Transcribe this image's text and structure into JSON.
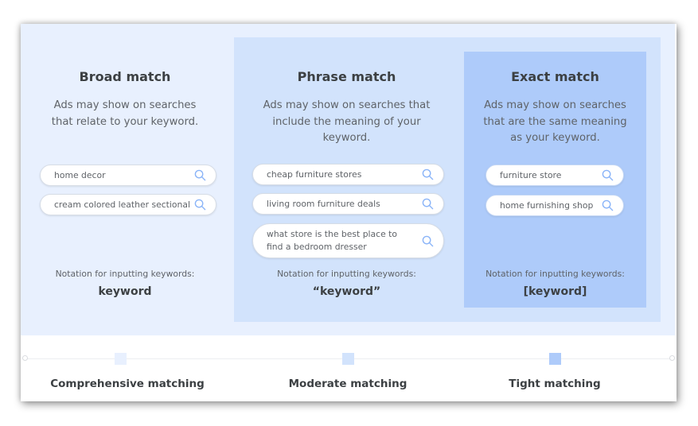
{
  "colors": {
    "broad_bg": "#e8f0fe",
    "phrase_bg": "#d2e3fc",
    "exact_bg": "#aecbfa",
    "search_icon": "#8ab4f8",
    "heading_text": "#3c4043",
    "body_text": "#5f6368"
  },
  "columns": [
    {
      "title": "Broad match",
      "description_lines": [
        "Ads may show on searches",
        "that relate to your keyword."
      ],
      "searches": [
        "home decor",
        "cream colored leather sectional"
      ],
      "notation_label": "Notation for inputting keywords:",
      "notation": "keyword"
    },
    {
      "title": "Phrase match",
      "description_lines": [
        "Ads may show on searches that",
        "include the meaning of your",
        "keyword."
      ],
      "searches": [
        "cheap furniture stores",
        "living room furniture deals",
        "what store is the best place to find a bedroom dresser"
      ],
      "notation_label": "Notation for inputting keywords:",
      "notation": "“keyword”"
    },
    {
      "title": "Exact match",
      "description_lines": [
        "Ads may show on searches",
        "that are the same meaning",
        "as your keyword."
      ],
      "searches": [
        "furniture store",
        "home furnishing shop"
      ],
      "notation_label": "Notation for inputting keywords:",
      "notation": "[keyword]"
    }
  ],
  "timeline": {
    "labels": [
      "Comprehensive matching",
      "Moderate matching",
      "Tight matching"
    ]
  },
  "icons": {
    "search": "search-icon"
  }
}
